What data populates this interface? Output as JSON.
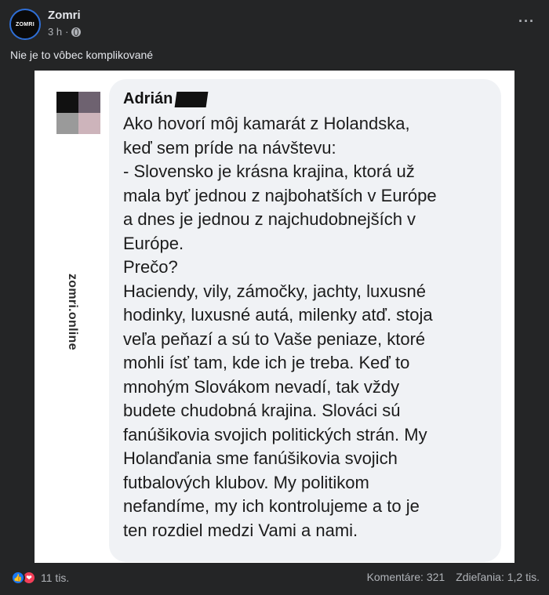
{
  "post": {
    "page_name": "Zomri",
    "avatar_text": "ZOMRI",
    "time": "3 h",
    "separator": "·",
    "more": "···",
    "caption": "Nie je to vôbec komplikované"
  },
  "image": {
    "watermark": "zomri.online",
    "comment": {
      "author": "Adrián",
      "text": "Ako hovorí môj kamarát z Holandska,\nkeď sem príde na návštevu:\n- Slovensko je krásna krajina, ktorá už\nmala byť jednou z najbohatších v Európe\na dnes je jednou z najchudobnejších v\nEurópe.\nPrečo?\nHaciendy, vily, zámočky, jachty, luxusné\nhodinky, luxusné autá, milenky atď. stoja\nveľa peňazí a sú to Vaše peniaze, ktoré\nmohli ísť tam, kde ich je treba. Keď to\nmnohým Slovákom nevadí, tak vždy\nbudete chudobná krajina. Slováci sú\nfanúšikovia svojich politických strán. My\nHolanďania sme fanúšikovia svojich\nfutbalových klubov. My politikom\nnefandíme, my ich kontrolujeme a to je\nten rozdiel medzi Vami a nami."
    }
  },
  "footer": {
    "reaction_count": "11 tis.",
    "comments": "Komentáre: 321",
    "shares": "Zdieľania: 1,2 tis."
  },
  "colors": {
    "background": "#242526",
    "like": "#1877f2",
    "love": "#f33e58"
  }
}
